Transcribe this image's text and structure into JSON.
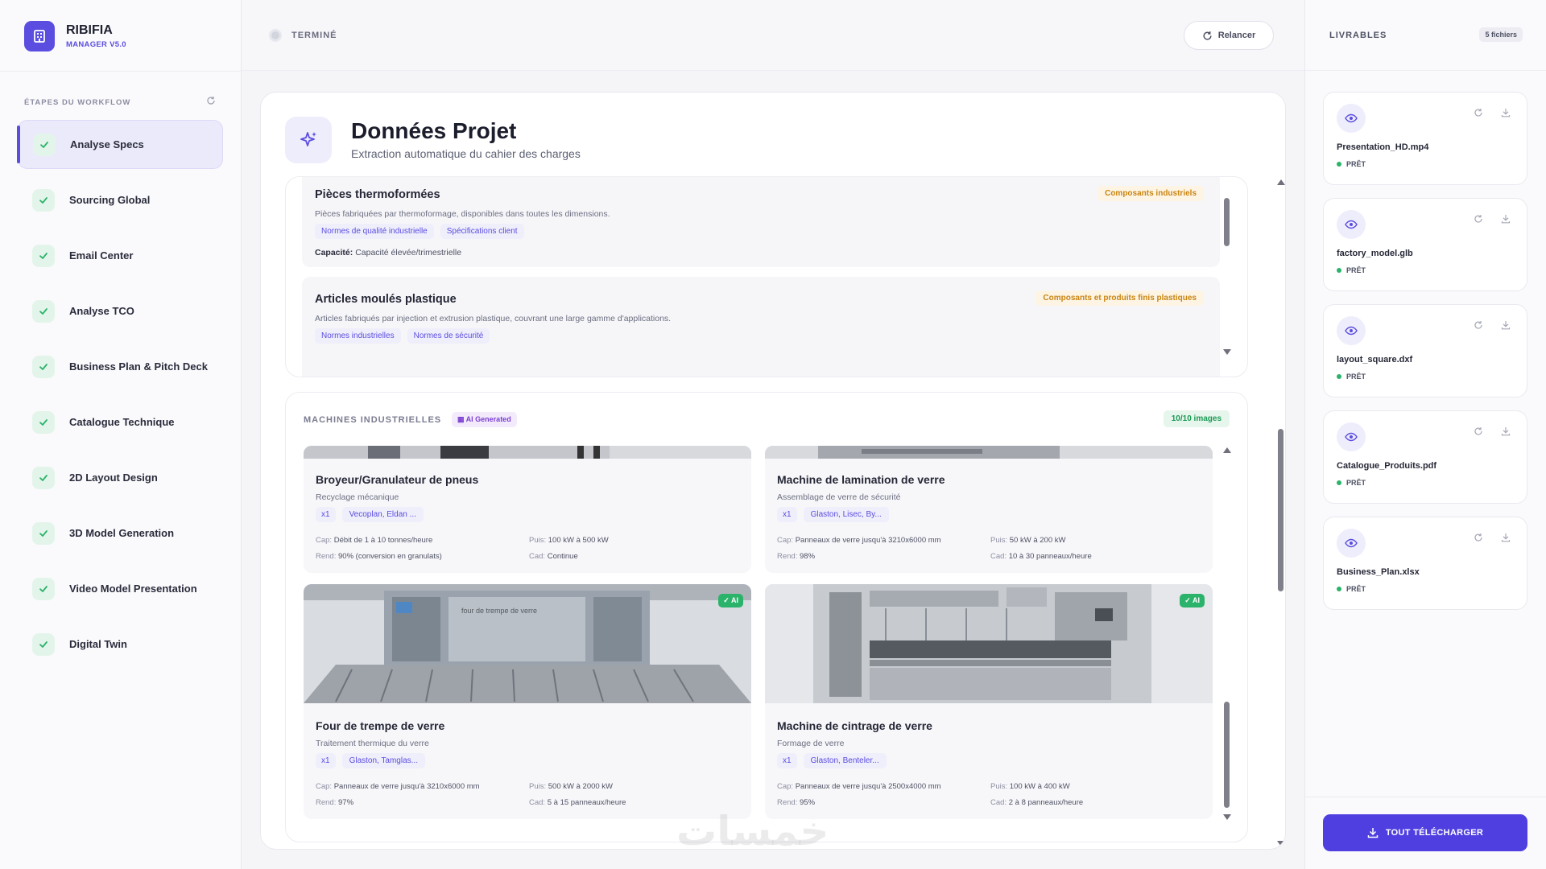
{
  "brand": {
    "name": "RIBIFIA",
    "version": "MANAGER V5.0"
  },
  "workflow": {
    "title": "ÉTAPES DU WORKFLOW",
    "steps": [
      {
        "label": "Analyse Specs",
        "active": true
      },
      {
        "label": "Sourcing Global"
      },
      {
        "label": "Email Center"
      },
      {
        "label": "Analyse TCO"
      },
      {
        "label": "Business Plan & Pitch Deck"
      },
      {
        "label": "Catalogue Technique"
      },
      {
        "label": "2D Layout Design"
      },
      {
        "label": "3D Model Generation"
      },
      {
        "label": "Video Model Presentation"
      },
      {
        "label": "Digital Twin"
      }
    ]
  },
  "topbar": {
    "status": "TERMINÉ",
    "relaunch_label": "Relancer"
  },
  "header": {
    "title": "Données Projet",
    "subtitle": "Extraction automatique du cahier des charges"
  },
  "products": [
    {
      "title": "Pièces thermoformées",
      "category": "Composants industriels",
      "description": "Pièces fabriquées par thermoformage, disponibles dans toutes les dimensions.",
      "tags": [
        "Normes de qualité industrielle",
        "Spécifications client"
      ],
      "capacity_label": "Capacité:",
      "capacity": "Capacité élevée/trimestrielle"
    },
    {
      "title": "Articles moulés plastique",
      "category": "Composants et produits finis plastiques",
      "description": "Articles fabriqués par injection et extrusion plastique, couvrant une large gamme d'applications.",
      "tags": [
        "Normes industrielles",
        "Normes de sécurité"
      ]
    }
  ],
  "machines": {
    "title": "MACHINES INDUSTRIELLES",
    "ai_badge": "AI Generated",
    "image_count": "10/10 images",
    "ai_label": "✓ AI",
    "labels": {
      "cap": "Cap:",
      "puis": "Puis:",
      "rend": "Rend:",
      "cad": "Cad:"
    },
    "items": [
      {
        "title": "Broyeur/Granulateur de pneus",
        "subtitle": "Recyclage mécanique",
        "qty": "x1",
        "suppliers": "Vecoplan, Eldan ...",
        "cap": "Débit de 1 à 10 tonnes/heure",
        "puis": "100 kW à 500 kW",
        "rend": "90% (conversion en granulats)",
        "cad": "Continue"
      },
      {
        "title": "Machine de lamination de verre",
        "subtitle": "Assemblage de verre de sécurité",
        "qty": "x1",
        "suppliers": "Glaston, Lisec, By...",
        "cap": "Panneaux de verre jusqu'à 3210x6000 mm",
        "puis": "50 kW à 200 kW",
        "rend": "98%",
        "cad": "10 à 30 panneaux/heure"
      },
      {
        "title": "Four de trempe de verre",
        "subtitle": "Traitement thermique du verre",
        "qty": "x1",
        "suppliers": "Glaston, Tamglas...",
        "cap": "Panneaux de verre jusqu'à 3210x6000 mm",
        "puis": "500 kW à 2000 kW",
        "rend": "97%",
        "cad": "5 à 15 panneaux/heure",
        "image_text": "four de trempe de verre"
      },
      {
        "title": "Machine de cintrage de verre",
        "subtitle": "Formage de verre",
        "qty": "x1",
        "suppliers": "Glaston, Benteler...",
        "cap": "Panneaux de verre jusqu'à 2500x4000 mm",
        "puis": "100 kW à 400 kW",
        "rend": "95%",
        "cad": "2 à 8 panneaux/heure"
      }
    ]
  },
  "deliverables": {
    "title": "LIVRABLES",
    "count": "5 fichiers",
    "ready_label": "PRÊT",
    "files": [
      {
        "name": "Presentation_HD.mp4"
      },
      {
        "name": "factory_model.glb"
      },
      {
        "name": "layout_square.dxf"
      },
      {
        "name": "Catalogue_Produits.pdf"
      },
      {
        "name": "Business_Plan.xlsx"
      }
    ],
    "download_all": "TOUT TÉLÉCHARGER"
  },
  "colors": {
    "accent": "#5b4de0",
    "success": "#2cb36b",
    "warning": "#c98512"
  },
  "watermark": "خمسات"
}
